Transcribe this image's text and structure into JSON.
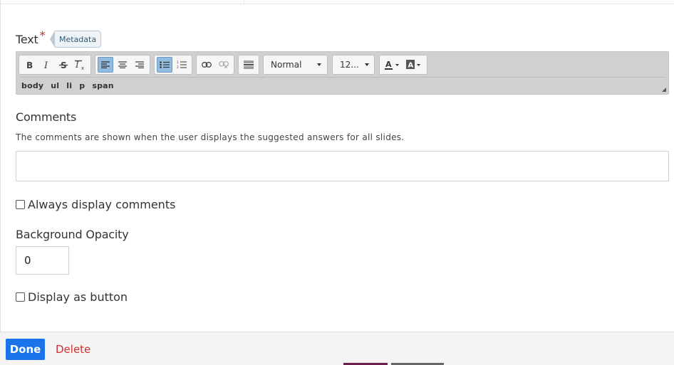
{
  "text_field": {
    "label": "Text",
    "required_mark": "*",
    "metadata_label": "Metadata"
  },
  "editor": {
    "toolbar": {
      "format_select": "Normal",
      "size_select": "12..."
    },
    "path": [
      "body",
      "ul",
      "li",
      "p",
      "span"
    ],
    "icons": [
      "bold-icon",
      "italic-icon",
      "strikethrough-icon",
      "remove-format-icon",
      "align-left-icon",
      "align-center-icon",
      "align-right-icon",
      "bulleted-list-icon",
      "numbered-list-icon",
      "link-icon",
      "unlink-icon",
      "horizontal-rule-icon",
      "text-color-icon",
      "background-color-icon"
    ]
  },
  "comments": {
    "label": "Comments",
    "description": "The comments are shown when the user displays the suggested answers for all slides.",
    "value": ""
  },
  "always_display": {
    "label": "Always display comments",
    "checked": false
  },
  "background_opacity": {
    "label": "Background Opacity",
    "value": "0"
  },
  "display_as_button": {
    "label": "Display as button",
    "checked": false
  },
  "footer": {
    "done_label": "Done",
    "delete_label": "Delete"
  },
  "colors": {
    "accent": "#1a73e8",
    "danger": "#d32f2f",
    "required": "#c5282f",
    "active_tool": "#92bbdf"
  }
}
